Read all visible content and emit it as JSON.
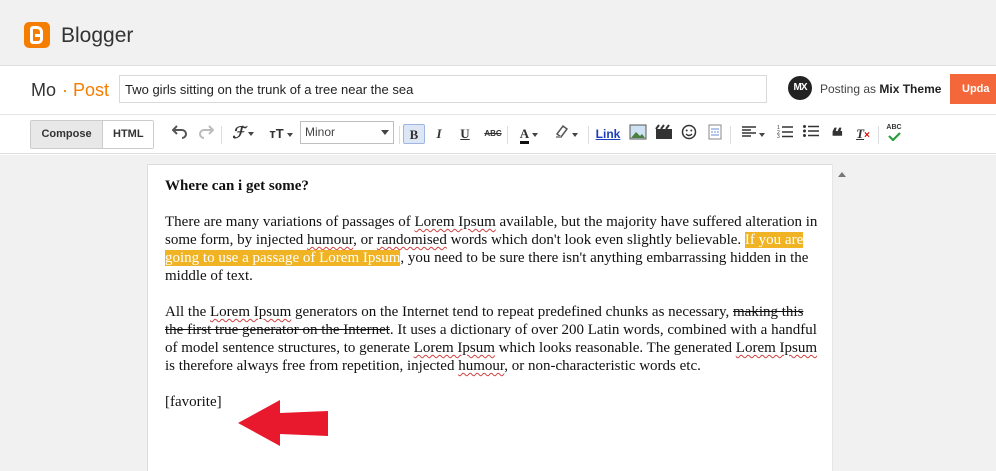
{
  "app": {
    "name": "Blogger"
  },
  "post": {
    "blog_short": "Mo",
    "separator": "·",
    "section": "Post",
    "title": "Two girls sitting on the trunk of a tree near the sea"
  },
  "account": {
    "prefix": "Posting as",
    "name": "Mix Theme",
    "avatar_text": "MX"
  },
  "actions": {
    "update": "Upda"
  },
  "toolbar": {
    "compose": "Compose",
    "html": "HTML",
    "font": "Minor",
    "link": "Link",
    "bold": "B",
    "italic": "I",
    "underline": "U",
    "strike": "ABC",
    "spell": "ABC"
  },
  "content": {
    "heading": "Where can i get some?",
    "p1_a": "There are many variations of passages of ",
    "p1_b": "Lorem Ipsum",
    "p1_c": " available, but the majority have suffered alteration in some form, by injected ",
    "p1_d": "humour",
    "p1_e": ", or ",
    "p1_f": "randomised",
    "p1_g": " words which don't look even slightly believable. ",
    "p1_h": "If you are going to use a passage of Lorem Ipsum",
    "p1_i": ", you need to be sure there isn't anything embarrassing hidden in the middle of text.",
    "p2_a": "All the ",
    "p2_b": "Lorem Ipsum",
    "p2_c": " generators on the Internet tend to repeat predefined chunks as necessary, ",
    "p2_d": "making this the first true generator on the Internet",
    "p2_e": ". It uses a dictionary of over 200 Latin words, combined with a handful of model sentence structures, to generate ",
    "p2_f": "Lorem Ipsum",
    "p2_g": " which looks reasonable. The generated ",
    "p2_h": "Lorem Ipsum",
    "p2_i": " is therefore always free from repetition, injected ",
    "p2_j": "humour",
    "p2_k": ", or non-characteristic words etc.",
    "shortcode": "[favorite]"
  },
  "colors": {
    "accent": "#f57d00",
    "update": "#f4673b",
    "highlight": "#f0b323",
    "arrow": "#e8192c"
  }
}
